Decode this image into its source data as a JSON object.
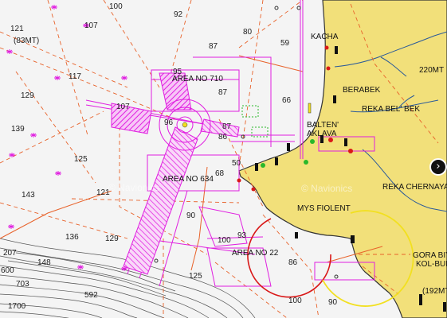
{
  "soundings": [
    {
      "id": "s100a",
      "text": "100"
    },
    {
      "id": "s92",
      "text": "92"
    },
    {
      "id": "s121",
      "text": "121"
    },
    {
      "id": "s83mt",
      "text": "(83MT)"
    },
    {
      "id": "s107a",
      "text": "107"
    },
    {
      "id": "s87a",
      "text": "87"
    },
    {
      "id": "s80",
      "text": "80"
    },
    {
      "id": "s59",
      "text": "59"
    },
    {
      "id": "s117",
      "text": "117"
    },
    {
      "id": "s95",
      "text": "95"
    },
    {
      "id": "s129a",
      "text": "129"
    },
    {
      "id": "s87b",
      "text": "87"
    },
    {
      "id": "s66",
      "text": "66"
    },
    {
      "id": "s107b",
      "text": "107"
    },
    {
      "id": "s139",
      "text": "139"
    },
    {
      "id": "s96",
      "text": "96"
    },
    {
      "id": "s87c",
      "text": "87"
    },
    {
      "id": "s86a",
      "text": "86"
    },
    {
      "id": "s125a",
      "text": "125"
    },
    {
      "id": "s50",
      "text": "50"
    },
    {
      "id": "s68",
      "text": "68"
    },
    {
      "id": "s143",
      "text": "143"
    },
    {
      "id": "s121b",
      "text": "121"
    },
    {
      "id": "s90a",
      "text": "90"
    },
    {
      "id": "s136",
      "text": "136"
    },
    {
      "id": "s129b",
      "text": "129"
    },
    {
      "id": "s93",
      "text": "93"
    },
    {
      "id": "s100b",
      "text": "100"
    },
    {
      "id": "s207",
      "text": "207"
    },
    {
      "id": "s148",
      "text": "148"
    },
    {
      "id": "s600",
      "text": "600"
    },
    {
      "id": "s703",
      "text": "703"
    },
    {
      "id": "s125b",
      "text": "125"
    },
    {
      "id": "s86b",
      "text": "86"
    },
    {
      "id": "s592",
      "text": "592"
    },
    {
      "id": "s1700",
      "text": "1700"
    },
    {
      "id": "s100c",
      "text": "100"
    },
    {
      "id": "s90b",
      "text": "90"
    }
  ],
  "area_labels": [
    {
      "id": "area710",
      "text": "AREA NO 710"
    },
    {
      "id": "area634",
      "text": "AREA NO 634"
    },
    {
      "id": "area22",
      "text": "AREA NO 22"
    }
  ],
  "place_labels": [
    {
      "id": "kacha",
      "text": "KACHA"
    },
    {
      "id": "berabek",
      "text": "BERABEK"
    },
    {
      "id": "reka_bel_bek",
      "text": "REKA BEL' BEK"
    },
    {
      "id": "balten",
      "text": "BALTEN'"
    },
    {
      "id": "aklava",
      "text": "AKLAVA"
    },
    {
      "id": "mys_fiolent",
      "text": "MYS FIOLENT"
    },
    {
      "id": "reka_chernaya",
      "text": "REKA CHERNAYA"
    },
    {
      "id": "gora_biy",
      "text": "GORA BIY"
    },
    {
      "id": "kol_bur",
      "text": "KOL-BUR"
    }
  ],
  "height_labels": [
    {
      "id": "h220",
      "text": "220MT"
    },
    {
      "id": "h192",
      "text": "(192MT"
    }
  ],
  "watermarks": [
    {
      "id": "wm1",
      "text": "© Navionics"
    },
    {
      "id": "wm2",
      "text": "© Navionics"
    }
  ],
  "nav_button": {
    "label": "›"
  },
  "colors": {
    "sea": "#f4f4f4",
    "land": "#f2e07a",
    "restricted": "#e01ee0",
    "traffic": "#e8622a",
    "coast": "#333333",
    "river": "#2a5a9a",
    "sector_red": "#d91818",
    "sector_yellow": "#f2e020"
  }
}
